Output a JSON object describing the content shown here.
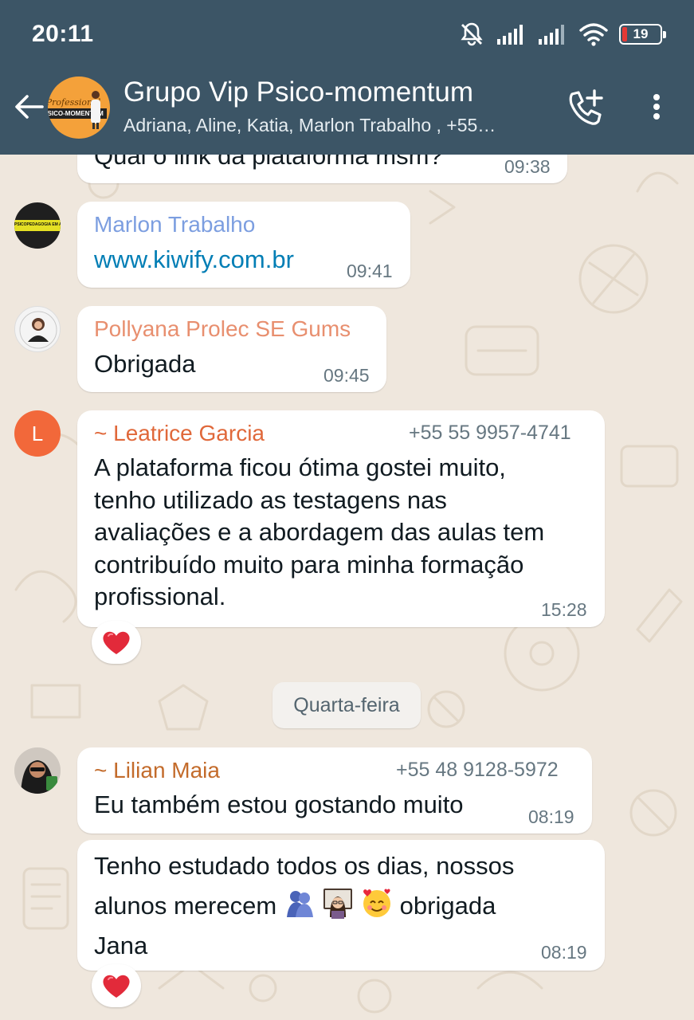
{
  "status_bar": {
    "time": "20:11",
    "battery": "19",
    "icons": [
      "mute-bell-icon",
      "signal-icon",
      "signal-icon",
      "wifi-icon",
      "battery-icon"
    ]
  },
  "header": {
    "title": "Grupo Vip Psico-momentum",
    "subtitle": "Adriana, Aline, Katia, Marlon Trabalho , +55…",
    "avatar_text": {
      "script": "Professional",
      "band": "PSICO-MOMENTUM"
    },
    "actions": [
      "back-arrow-icon",
      "add-call-icon",
      "more-vert-icon"
    ]
  },
  "colors": {
    "header_bg": "#3c5566",
    "chat_bg": "#efe7dd",
    "bubble_bg": "#ffffff",
    "link": "#027eb5",
    "sender_marlon": "#7c9ee0",
    "sender_pollyana": "#e88f6f",
    "sender_leatrice": "#e0683a",
    "sender_lilian": "#c36b2b",
    "avatar_leatrice": "#f2683a",
    "reaction_heart": "#e22a3a"
  },
  "messages": [
    {
      "id": "m0",
      "body": "Qual o link da plataforma msm?",
      "time": "09:38"
    },
    {
      "id": "m1",
      "sender": "Marlon Trabalho",
      "body": "www.kiwify.com.br",
      "time": "09:41",
      "avatar_text": "PSICOPEDAGOGIA EM AÇÃO"
    },
    {
      "id": "m2",
      "sender": "Pollyana Prolec SE Gums",
      "body": "Obrigada",
      "time": "09:45"
    },
    {
      "id": "m3",
      "sender": "~ Leatrice Garcia",
      "phone": "+55 55 9957-4741",
      "avatar_letter": "L",
      "lines": [
        "A plataforma ficou ótima gostei muito,",
        "tenho utilizado as testagens nas",
        "avaliações e a abordagem das aulas tem",
        "contribuído muito para minha formação",
        "profissional."
      ],
      "time": "15:28",
      "reaction": "heart-icon"
    },
    {
      "id": "m4",
      "sender": "~ Lilian Maia",
      "phone": "+55 48 9128-5972",
      "body": "Eu também estou gostando muito",
      "time": "08:19"
    },
    {
      "id": "m5",
      "line1": "Tenho estudado todos os dias, nossos",
      "line2_pre": "alunos merecem",
      "line2_post": "obrigada",
      "line3": "Jana",
      "emojis": [
        "hugging-people-emoji",
        "woman-teacher-emoji",
        "smiling-face-hearts-emoji"
      ],
      "time": "08:19",
      "reaction": "heart-icon"
    }
  ],
  "date_separator": "Quarta-feira"
}
